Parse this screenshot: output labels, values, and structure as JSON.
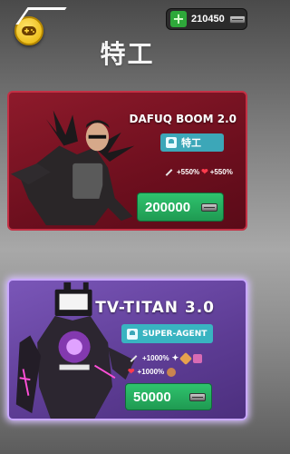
{
  "header": {
    "title": "特工",
    "currency": {
      "value": "210450",
      "plus_label": "+"
    }
  },
  "cards": [
    {
      "name": "DAFUQ BOOM 2.0",
      "rank_label": "特工",
      "stat_attack": "+550%",
      "stat_health": "+550%",
      "price": "200000",
      "accent": "#c43145"
    },
    {
      "name": "TV-TITAN 3.0",
      "rank_label": "SUPER-AGENT",
      "stat_attack": "+1000%",
      "stat_health": "+1000%",
      "price": "50000",
      "accent": "#c9a8ff"
    }
  ]
}
